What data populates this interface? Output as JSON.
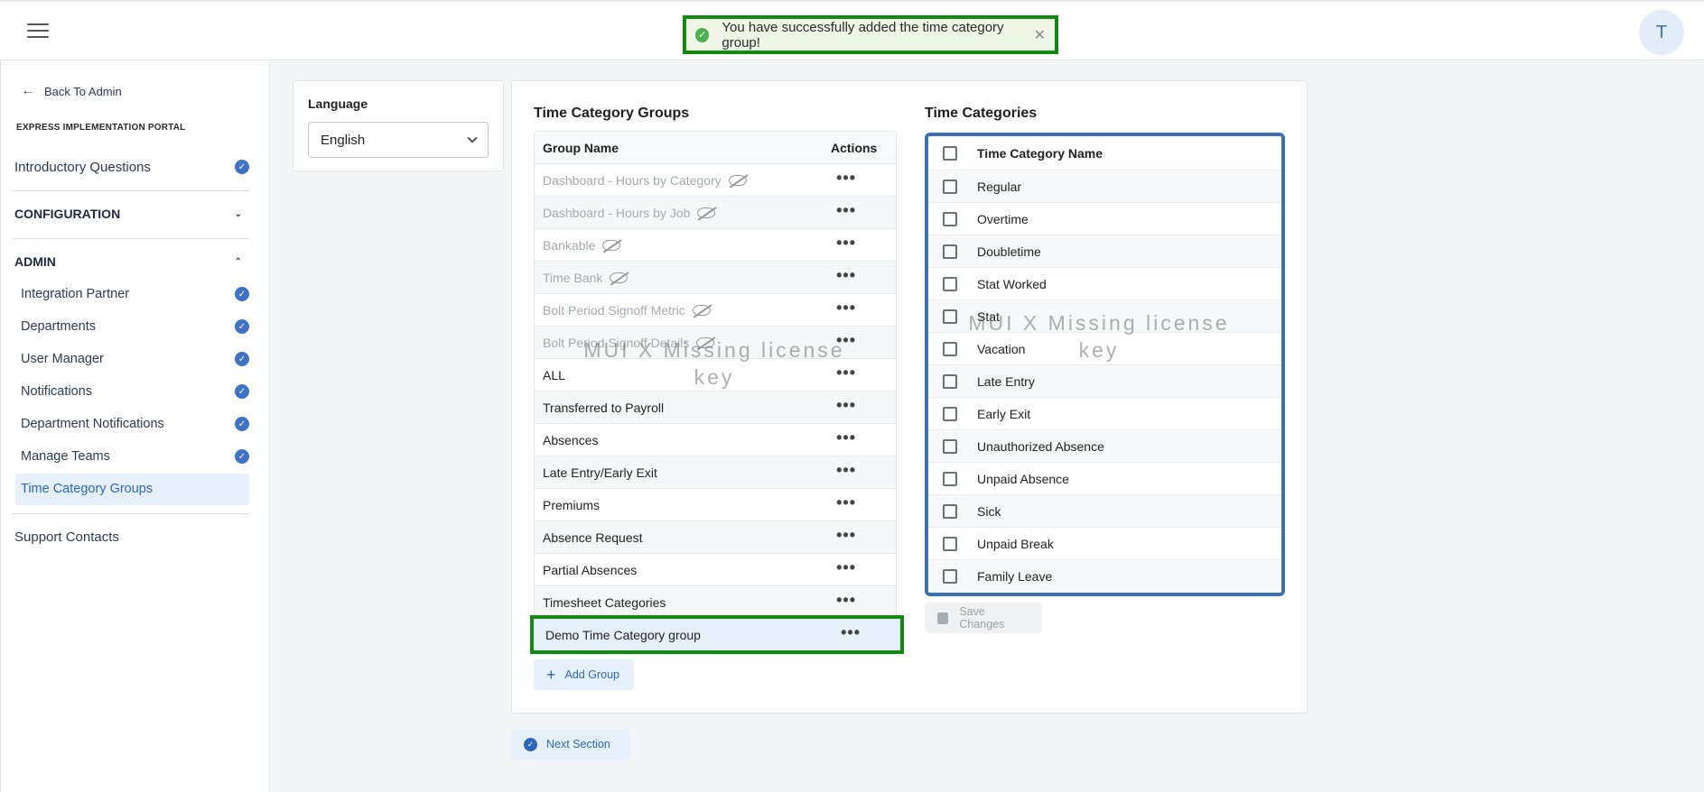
{
  "header": {
    "toast_message": "You have successfully added the time category group!",
    "avatar_initial": "T"
  },
  "sidebar": {
    "back_label": "Back To Admin",
    "portal_title": "EXPRESS IMPLEMENTATION PORTAL",
    "intro": "Introductory Questions",
    "configuration": "CONFIGURATION",
    "admin": "ADMIN",
    "admin_items": [
      "Integration Partner",
      "Departments",
      "User Manager",
      "Notifications",
      "Department Notifications",
      "Manage Teams",
      "Time Category Groups"
    ],
    "support": "Support Contacts",
    "check_color": "#3d72c4"
  },
  "language": {
    "label": "Language",
    "value": "English"
  },
  "groups": {
    "title": "Time Category Groups",
    "col_name": "Group Name",
    "col_actions": "Actions",
    "rows": [
      "Dashboard - Hours by Category",
      "Dashboard - Hours by Job",
      "Bankable",
      "Time Bank",
      "Bolt Period Signoff Metric",
      "Bolt Period Signoff Details",
      "ALL",
      "Transferred to Payroll",
      "Absences",
      "Late Entry/Early Exit",
      "Premiums",
      "Absence Request",
      "Partial Absences",
      "Timesheet Categories",
      "Demo Time Category group"
    ],
    "add_label": "Add Group",
    "actions_glyph": "•••"
  },
  "categories": {
    "title": "Time Categories",
    "col_name": "Time Category Name",
    "rows": [
      "Regular",
      "Overtime",
      "Doubletime",
      "Stat Worked",
      "Stat",
      "Vacation",
      "Late Entry",
      "Early Exit",
      "Unauthorized Absence",
      "Unpaid Absence",
      "Sick",
      "Unpaid Break",
      "Family Leave"
    ],
    "save_label": "Save Changes"
  },
  "next_label": "Next Section",
  "watermark": "MUI X Missing license key",
  "highlight_color": "#128a12"
}
